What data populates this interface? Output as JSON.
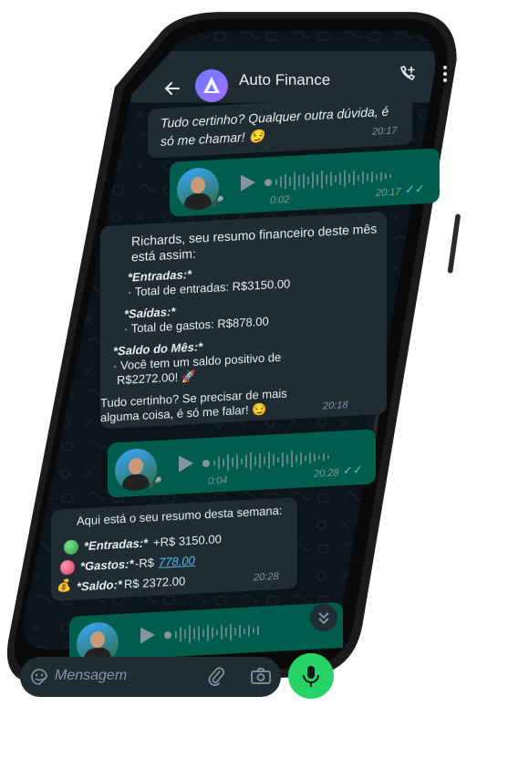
{
  "header": {
    "title": "Auto Finance",
    "back_icon": "arrow-left-icon",
    "call_icon": "add-call-icon",
    "menu_icon": "more-vertical-icon"
  },
  "messages": [
    {
      "type": "text-in",
      "lines": [
        "Tudo certinho? Qualquer outra dúvida, é",
        "só me chamar! 😏"
      ],
      "time": "20:17"
    },
    {
      "type": "voice-out",
      "duration": "0:02",
      "time": "20:17"
    },
    {
      "type": "text-in",
      "lines": [
        "Richards, seu resumo financeiro deste mês",
        "está assim:",
        "",
        "*Entradas:*",
        "· Total de entradas: R$3150.00",
        "",
        "*Saídas:*",
        "· Total de gastos: R$878.00",
        "",
        "*Saldo do Mês:*",
        "· Você tem um saldo positivo de",
        "R$2272.00! 🚀",
        "",
        "Tudo certinho? Se precisar de mais",
        "alguma coisa, é só me falar! 😏"
      ],
      "time": "20:18"
    },
    {
      "type": "voice-out",
      "duration": "0:04",
      "time": "20:28"
    },
    {
      "type": "text-in",
      "intro": "Aqui está o seu resumo desta semana:",
      "rows": [
        {
          "label": "*Entradas:*",
          "value": "+R$ 3150.00",
          "link": ""
        },
        {
          "label": "*Gastos:*",
          "value": "-R$ ",
          "link": "778.00"
        },
        {
          "label": "*Saldo:*",
          "value": "R$ 2372.00",
          "link": ""
        }
      ],
      "time": "20:28"
    },
    {
      "type": "voice-out",
      "duration": "",
      "time": ""
    }
  ],
  "input": {
    "placeholder": "Mensagem"
  },
  "colors": {
    "bg": "#0b141a",
    "in": "#1f2c34",
    "out": "#005c4b",
    "accent": "#25d366",
    "link": "#53bdeb"
  }
}
